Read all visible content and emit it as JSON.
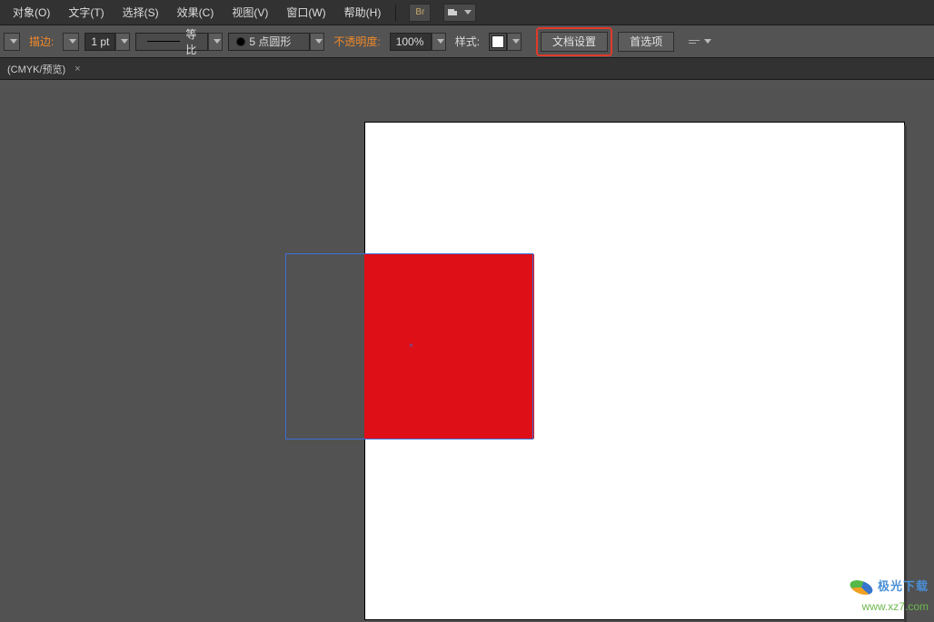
{
  "menubar": {
    "items": [
      {
        "label": "对象(O)"
      },
      {
        "label": "文字(T)"
      },
      {
        "label": "选择(S)"
      },
      {
        "label": "效果(C)"
      },
      {
        "label": "视图(V)"
      },
      {
        "label": "窗口(W)"
      },
      {
        "label": "帮助(H)"
      }
    ],
    "br_icon": "Br"
  },
  "optionsbar": {
    "stroke_label": "描边:",
    "stroke_weight": "1 pt",
    "uniform_label": "等比",
    "brush_label": "5 点圆形",
    "opacity_label": "不透明度:",
    "opacity_value": "100%",
    "style_label": "样式:",
    "doc_setup_label": "文档设置",
    "preferences_label": "首选项"
  },
  "tabbar": {
    "doc_title": "(CMYK/预览)"
  },
  "canvas": {
    "artboard_color": "#ffffff",
    "shape_fill": "#df0f18",
    "selection_color": "#3b6fd6"
  },
  "watermark": {
    "brand_main": "极光下载",
    "brand_sub": "www.xz7.com"
  }
}
